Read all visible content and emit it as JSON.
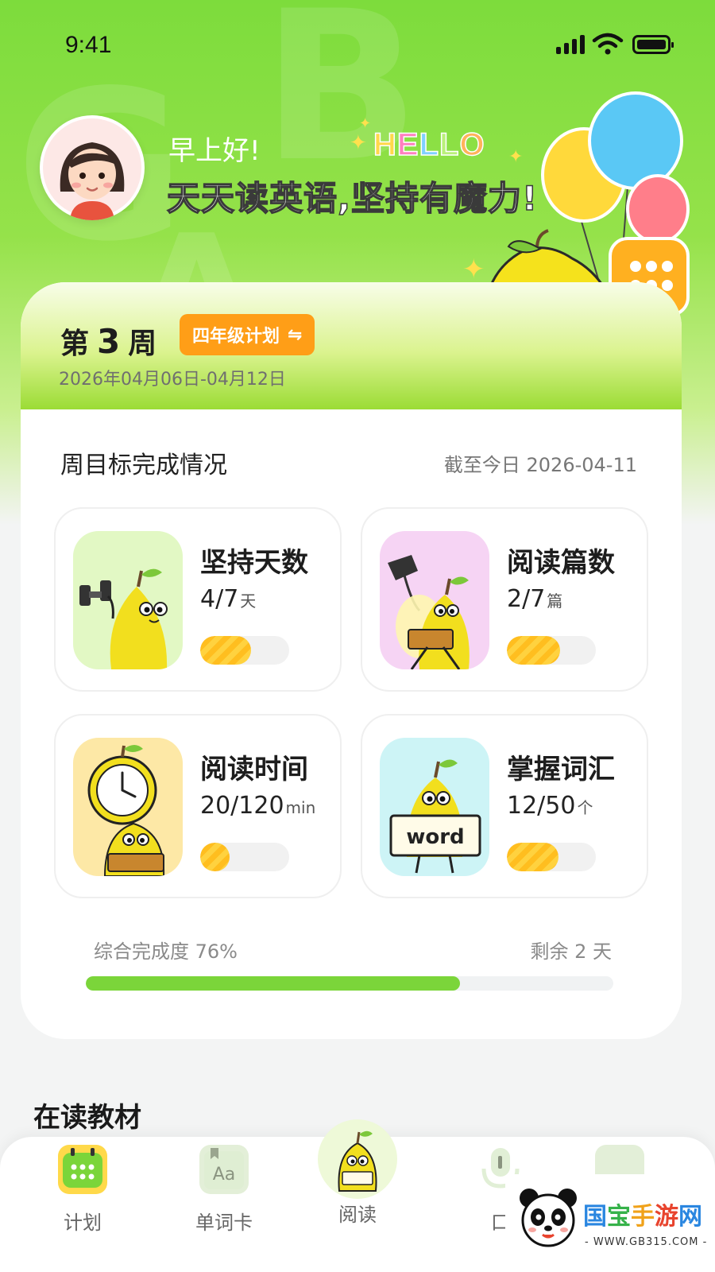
{
  "status_bar": {
    "time": "9:41"
  },
  "greeting": {
    "small": "早上好!",
    "hello": [
      "H",
      "E",
      "L",
      "L",
      "O"
    ],
    "slogan": "天天读英语,坚持有魔力!"
  },
  "plan": {
    "week_prefix": "第",
    "week_number": "3",
    "week_suffix": "周",
    "plan_name": "四年级计划",
    "switch_symbol": "⇋",
    "date_range": "2026年04月06日-04月12日"
  },
  "goals": {
    "section_title": "周目标完成情况",
    "as_of": "截至今日 2026-04-11",
    "items": [
      {
        "name": "坚持天数",
        "value": "4/7",
        "unit": "天",
        "progress": 0.57,
        "bg": "#e2f8c4"
      },
      {
        "name": "阅读篇数",
        "value": "2/7",
        "unit": "篇",
        "progress": 0.6,
        "bg": "#f6d4f4"
      },
      {
        "name": "阅读时间",
        "value": "20/120",
        "unit": "min",
        "progress": 0.33,
        "bg": "#fde8a6"
      },
      {
        "name": "掌握词汇",
        "value": "12/50",
        "unit": "个",
        "progress": 0.58,
        "bg": "#cdf4f6"
      }
    ],
    "overall_label": "综合完成度 76%",
    "overall_progress": 0.71,
    "remaining": "剩余 2 天"
  },
  "reading": {
    "title": "在读教材"
  },
  "tabs": [
    {
      "label": "计划",
      "icon": "calendar-icon",
      "active": true
    },
    {
      "label": "单词卡",
      "icon": "word-card-icon",
      "active": false
    },
    {
      "label": "阅读",
      "icon": "pear-reading-icon",
      "active": false
    },
    {
      "label": "口语",
      "icon": "microphone-icon",
      "active": false
    },
    {
      "label": "",
      "icon": "profile-icon",
      "active": false
    }
  ],
  "tab_visible_labels": [
    "计划",
    "单词卡",
    "阅读",
    "口"
  ],
  "word_sign": "word",
  "watermark": {
    "chars": [
      "国",
      "宝",
      "手",
      "游",
      "网"
    ],
    "url": "- WWW.GB315.COM -"
  },
  "colors": {
    "brand_green": "#7ddc3c",
    "accent_orange": "#ff9e17",
    "progress_yellow": "#ffc82a"
  }
}
